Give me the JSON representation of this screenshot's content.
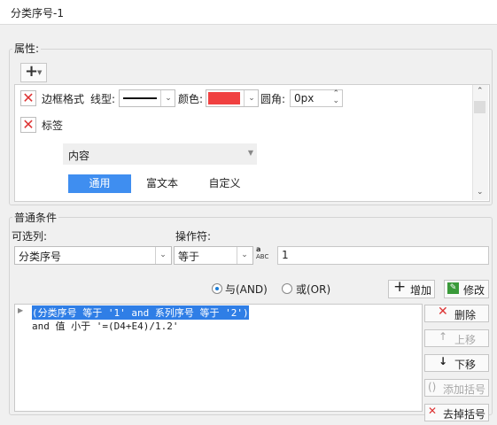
{
  "window": {
    "title": "分类序号-1"
  },
  "properties": {
    "group_label": "属性:",
    "border_row": {
      "label": "边框格式",
      "line_type_label": "线型:",
      "color_label": "颜色:",
      "radius_label": "圆角:",
      "radius_value": "0px",
      "color_hex": "#f04040"
    },
    "tag_row": {
      "label": "标签"
    },
    "content_label": "内容",
    "tabs": [
      "通用",
      "富文本",
      "自定义"
    ]
  },
  "conditions": {
    "group_label": "普通条件",
    "column_label": "可选列:",
    "column_value": "分类序号",
    "operator_label": "操作符:",
    "operator_value": "等于",
    "value": "1",
    "radio_and": "与(AND)",
    "radio_or": "或(OR)",
    "add_button": "增加",
    "modify_button": "修改",
    "list": [
      "(分类序号 等于 '1' and 系列序号 等于 '2')",
      "and 值 小于 '=(D4+E4)/1.2'"
    ],
    "side_buttons": {
      "delete": "删除",
      "up": "上移",
      "down": "下移",
      "add_bracket": "添加括号",
      "remove_bracket": "去掉括号"
    }
  },
  "colors": {
    "accent": "#2f7ee6",
    "danger": "#d33333"
  }
}
